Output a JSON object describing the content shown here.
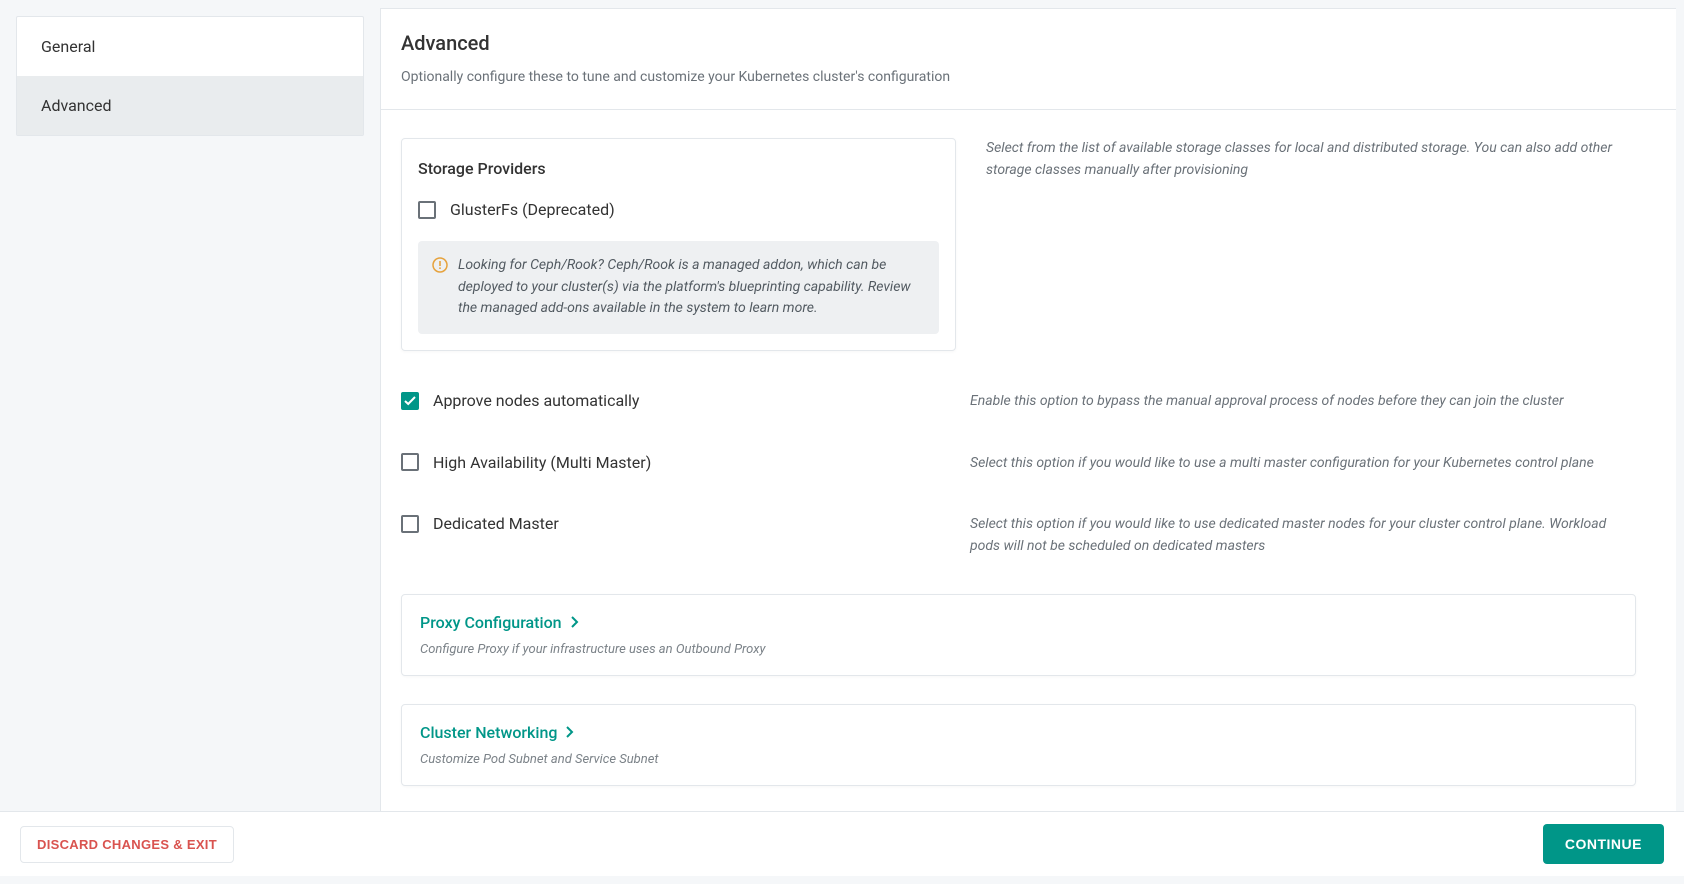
{
  "sidebar": {
    "items": [
      {
        "label": "General",
        "active": false
      },
      {
        "label": "Advanced",
        "active": true
      }
    ]
  },
  "header": {
    "title": "Advanced",
    "subtitle": "Optionally configure these to tune and customize your Kubernetes cluster's configuration"
  },
  "storage": {
    "title": "Storage Providers",
    "options": [
      {
        "label": "GlusterFs (Deprecated)",
        "checked": false
      }
    ],
    "info_text": "Looking for Ceph/Rook? Ceph/Rook is a managed addon, which can be deployed to your cluster(s) via the platform's blueprinting capability. Review the managed add-ons available in the system to learn more.",
    "desc": "Select from the list of available storage classes for local and distributed storage. You can also add other storage classes manually after provisioning"
  },
  "settings": [
    {
      "label": "Approve nodes automatically",
      "checked": true,
      "desc": "Enable this option to bypass the manual approval process of nodes before they can join the cluster"
    },
    {
      "label": "High Availability (Multi Master)",
      "checked": false,
      "desc": "Select this option if you would like to use a multi master configuration for your Kubernetes control plane"
    },
    {
      "label": "Dedicated Master",
      "checked": false,
      "desc": "Select this option if you would like to use dedicated master nodes for your cluster control plane. Workload pods will not be scheduled on dedicated masters"
    }
  ],
  "panels": [
    {
      "title": "Proxy Configuration",
      "desc": "Configure Proxy if your infrastructure uses an Outbound Proxy"
    },
    {
      "title": "Cluster Networking",
      "desc": "Customize Pod Subnet and Service Subnet"
    }
  ],
  "footer": {
    "discard": "DISCARD CHANGES & EXIT",
    "continue": "CONTINUE"
  }
}
